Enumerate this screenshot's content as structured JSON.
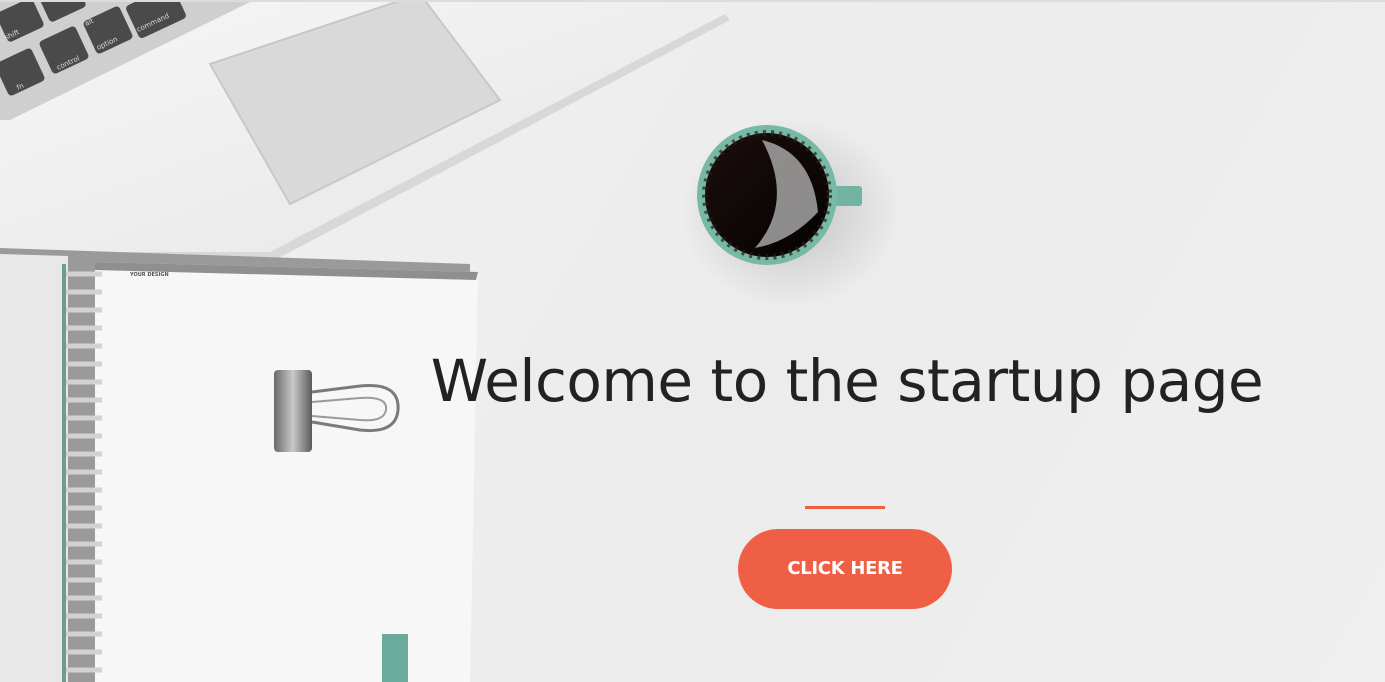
{
  "hero": {
    "headline": "Welcome to the startup page",
    "cta_label": "CLICK HERE",
    "accent_color": "#ef5f46",
    "notebook_label": "YOUR DESIGN"
  },
  "laptop_keys": [
    "fn",
    "control",
    "option",
    "command",
    "shift",
    "alt"
  ]
}
